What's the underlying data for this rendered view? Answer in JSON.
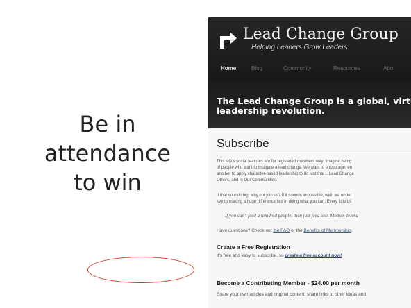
{
  "slide": {
    "caption_lines": [
      "Be in",
      "attendance",
      "to win"
    ]
  },
  "site": {
    "brand": "Lead Change Group",
    "tagline": "Helping Leaders Grow Leaders",
    "nav": [
      "Home",
      "Blog",
      "Community",
      "Resources",
      "Abo"
    ],
    "banner_lines": [
      "The Lead Change Group is a global, virtu",
      "leadership revolution."
    ],
    "heading": "Subscribe",
    "intro_lines": [
      "This site's social features are for registered members only.  Imagine being",
      "of people who want to instigate a lead change.  We want to encourage, en",
      "another to apply character-based leadership to do just that .. Lead Change",
      "Others, and in Our Communities."
    ],
    "second_lines": [
      "If that sounds big, why not join us?  If it sounds impossible, well, we under",
      "key to making a huge difference lies in doing what you can.  Every little bit"
    ],
    "quote": "If you can't feed a hundred people, then just feed one. Mother Teresa",
    "questions_prefix": "Have questions?  Check out ",
    "faq_link": "the FAQ",
    "questions_middle": " or the ",
    "benefits_link": "Benefits of Membership",
    "questions_suffix": ".",
    "free_heading": "Create a Free Registration",
    "free_text": "It's free and easy to subscribe, so ",
    "free_link": "create a free account now!",
    "member_heading": "Become a Contributing Member - $24.00 per month",
    "member_text": "Share your own articles and original content, share links to other ideas and"
  },
  "colors": {
    "header_bg": "#1f1f1f",
    "link": "#3d5f91",
    "highlight": "#d93224"
  }
}
